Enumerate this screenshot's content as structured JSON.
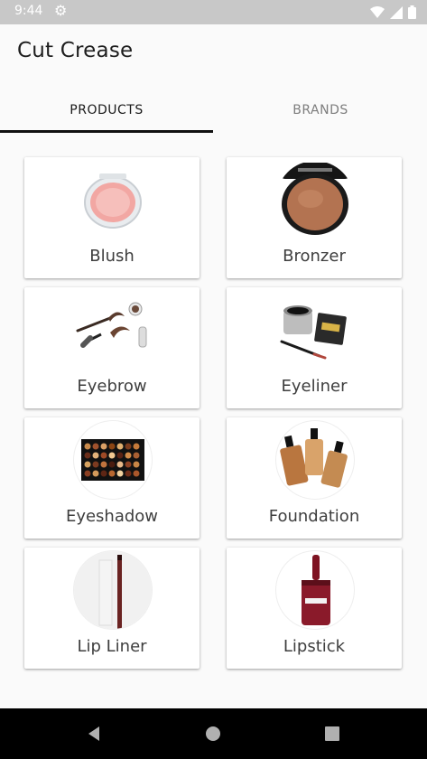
{
  "status_bar": {
    "time": "9:44",
    "icons": [
      "gear-icon",
      "wifi-icon",
      "signal-icon",
      "battery-icon"
    ]
  },
  "app": {
    "title": "Cut Crease"
  },
  "tabs": [
    {
      "label": "PRODUCTS",
      "active": true
    },
    {
      "label": "BRANDS",
      "active": false
    }
  ],
  "categories": [
    {
      "label": "Blush"
    },
    {
      "label": "Bronzer"
    },
    {
      "label": "Eyebrow"
    },
    {
      "label": "Eyeliner"
    },
    {
      "label": "Eyeshadow"
    },
    {
      "label": "Foundation"
    },
    {
      "label": "Lip Liner"
    },
    {
      "label": "Lipstick"
    }
  ],
  "nav_bar": {
    "buttons": [
      "back-icon",
      "home-icon",
      "recents-icon"
    ]
  }
}
